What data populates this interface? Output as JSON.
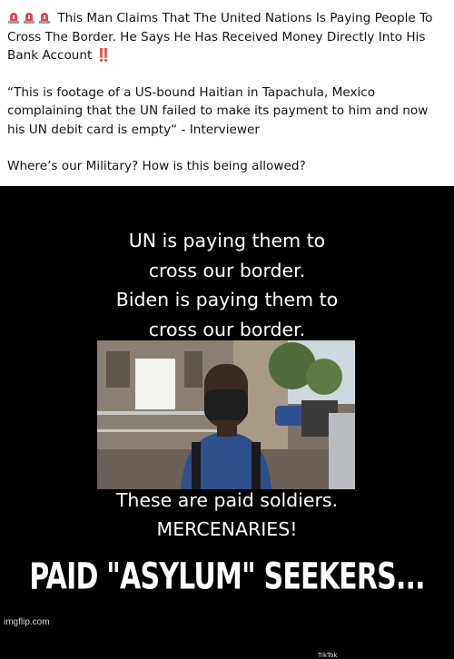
{
  "post": {
    "headline_text": "This Man Claims That The United Nations Is Paying People To Cross The Border. He Says He Has Received Money Directly Into His Bank Account",
    "headline_emphasis": "‼️",
    "quote": "“This is footage of a US-bound Haitian in Tapachula, Mexico complaining that the UN failed to make its payment to him and now his UN debit card is empty“ - Interviewer",
    "question": "Where’s our Military? How is this being allowed?"
  },
  "video": {
    "caption_1": "UN is paying them to",
    "caption_2": "cross our border.",
    "caption_3": "Biden is paying them to",
    "caption_4": "cross our border.",
    "caption_5": "These are paid soldiers.",
    "caption_6": "MERCENARIES!",
    "tiktok_badge": "TikTok"
  },
  "meme": {
    "bottom_text": "PAID \"ASYLUM\" SEEKERS...",
    "watermark": "imgflip.com"
  },
  "colors": {
    "siren": "#e8434a",
    "emphasis": "#d6212b"
  }
}
